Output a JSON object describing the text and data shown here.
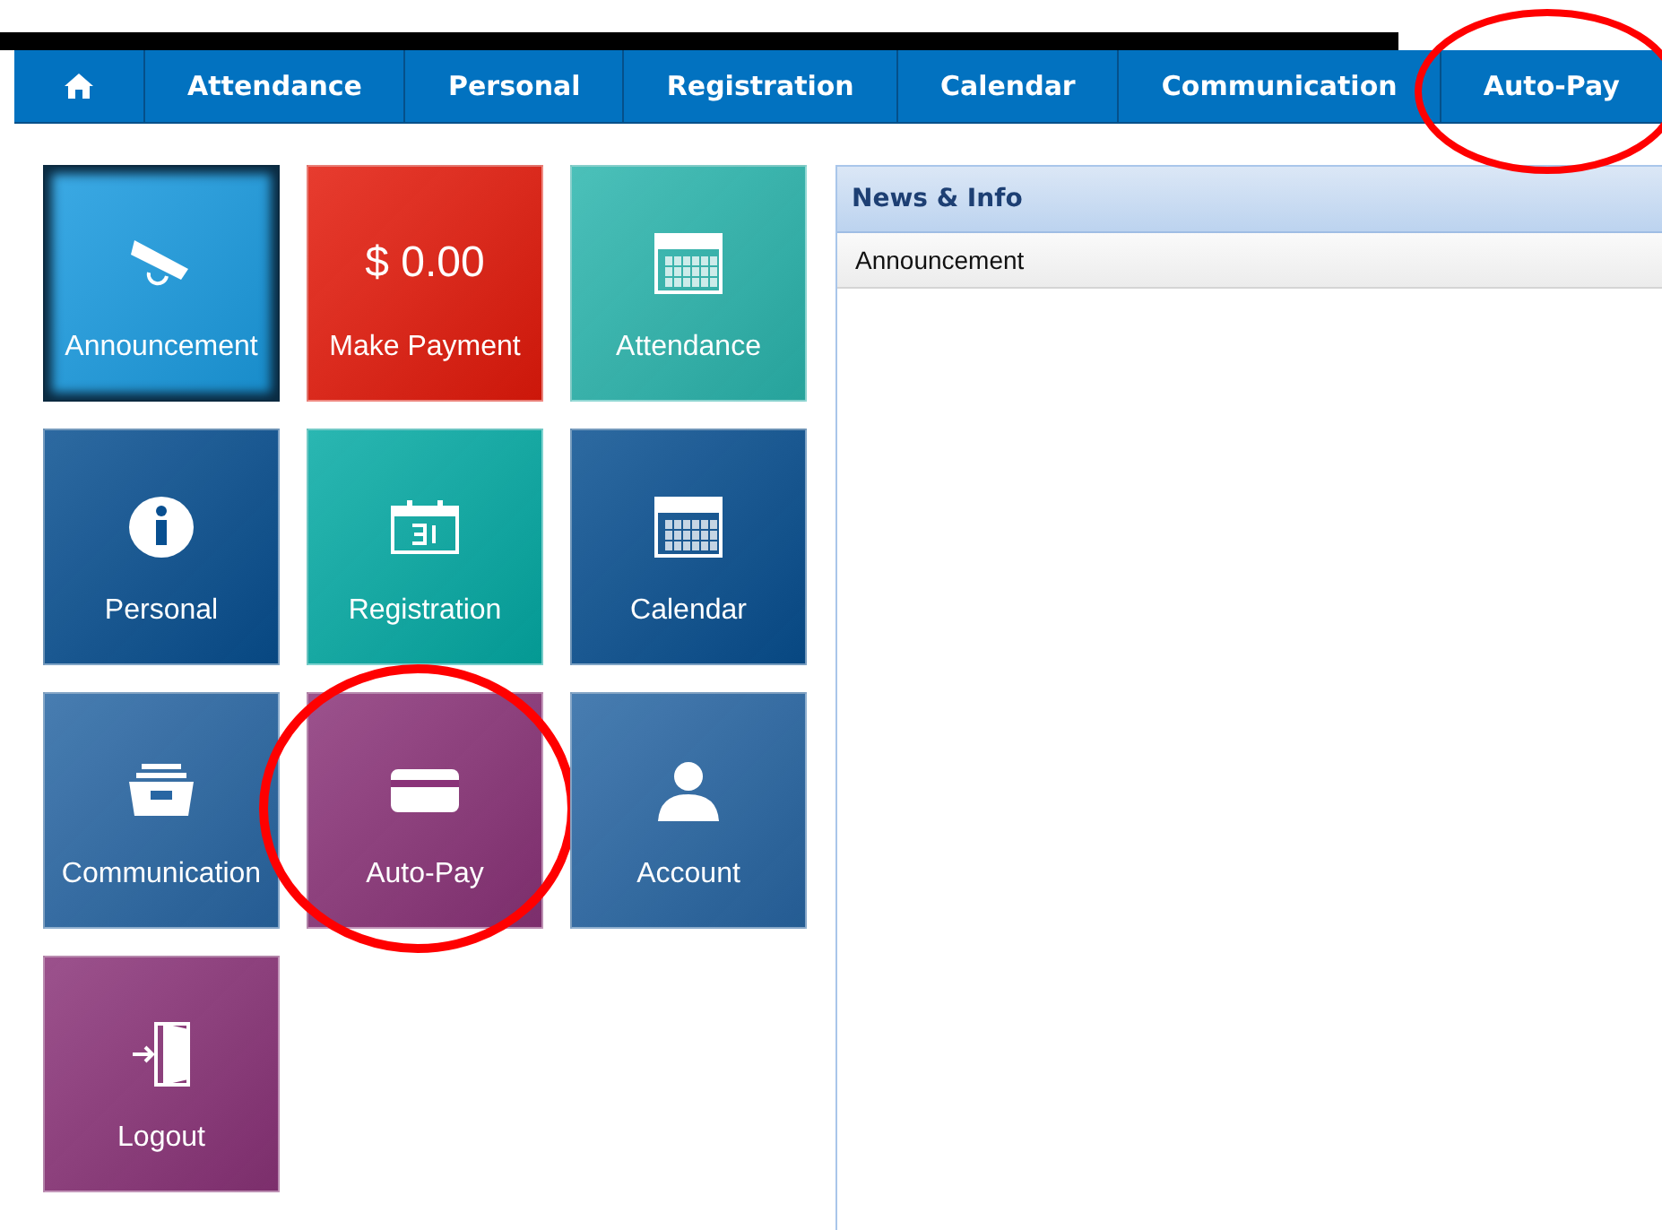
{
  "nav": [
    {
      "kind": "home",
      "circled": false
    },
    {
      "kind": "text",
      "label": "Attendance",
      "circled": false
    },
    {
      "kind": "text",
      "label": "Personal",
      "circled": false
    },
    {
      "kind": "text",
      "label": "Registration",
      "circled": false
    },
    {
      "kind": "text",
      "label": "Calendar",
      "circled": false
    },
    {
      "kind": "text",
      "label": "Communication",
      "circled": false
    },
    {
      "kind": "text",
      "label": "Auto-Pay",
      "circled": true
    }
  ],
  "tiles": [
    {
      "kind": "megaphone",
      "label": "Announcement",
      "color": "#1a9be0",
      "selected": true,
      "circled": false
    },
    {
      "kind": "amount",
      "amount": "$ 0.00",
      "label": "Make Payment",
      "color": "#e31a0b",
      "selected": false,
      "circled": false
    },
    {
      "kind": "calendar",
      "label": "Attendance",
      "color": "#2bb5ad",
      "selected": false,
      "circled": false
    },
    {
      "kind": "info",
      "label": "Personal",
      "color": "#084f90",
      "selected": false,
      "circled": false
    },
    {
      "kind": "date",
      "label": "Registration",
      "color": "#05aaa4",
      "selected": false,
      "circled": false
    },
    {
      "kind": "calendar",
      "label": "Calendar",
      "color": "#084f90",
      "selected": false,
      "circled": false
    },
    {
      "kind": "archive",
      "label": "Communication",
      "color": "#2866a3",
      "selected": false,
      "circled": false
    },
    {
      "kind": "card",
      "label": "Auto-Pay",
      "color": "#8a3378",
      "selected": false,
      "circled": true
    },
    {
      "kind": "person",
      "label": "Account",
      "color": "#2866a3",
      "selected": false,
      "circled": false
    },
    {
      "kind": "door",
      "label": "Logout",
      "color": "#8a3378",
      "selected": false,
      "circled": false
    }
  ],
  "panel": {
    "title": "News & Info",
    "items": [
      "Announcement"
    ]
  }
}
